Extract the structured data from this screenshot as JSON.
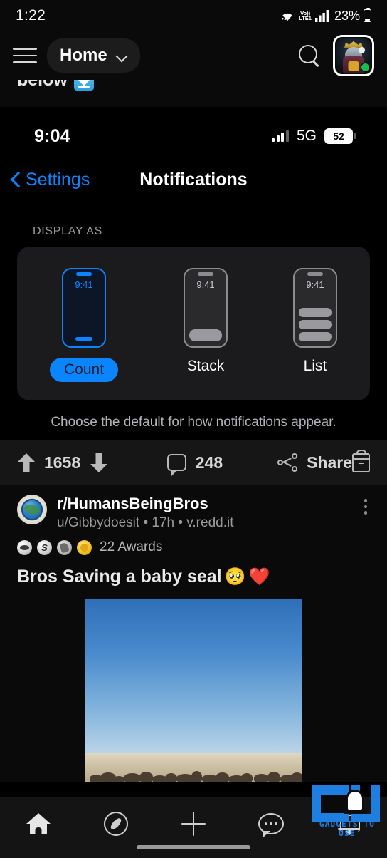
{
  "android_status": {
    "time": "1:22",
    "volte_top": "Vo))",
    "volte_bottom": "LTE1",
    "battery_percent": "23%",
    "wifi_icon": "wifi-icon",
    "signal_icon": "cellular-signal-icon",
    "battery_icon": "battery-icon"
  },
  "reddit_topbar": {
    "menu_icon": "hamburger-menu-icon",
    "feed_label": "Home",
    "chevron_icon": "chevron-down-icon",
    "search_icon": "search-icon",
    "avatar_name": "user-avatar",
    "online_status": "online"
  },
  "cutoff_post": {
    "text": "below",
    "emoji": "down-arrow-emoji"
  },
  "ios_screenshot": {
    "status": {
      "time": "9:04",
      "network": "5G",
      "battery": "52",
      "signal_icon": "cellular-signal-icon",
      "battery_icon": "battery-icon"
    },
    "nav": {
      "back_label": "Settings",
      "back_icon": "chevron-left-icon",
      "title": "Notifications"
    },
    "section_label": "DISPLAY AS",
    "options": [
      {
        "label": "Count",
        "phone_time": "9:41",
        "selected": true
      },
      {
        "label": "Stack",
        "phone_time": "9:41",
        "selected": false
      },
      {
        "label": "List",
        "phone_time": "9:41",
        "selected": false
      }
    ],
    "footnote": "Choose the default for how notifications appear.",
    "accent_color": "#0a84ff"
  },
  "action_bar": {
    "upvote_icon": "upvote-arrow-icon",
    "score": "1658",
    "downvote_icon": "downvote-arrow-icon",
    "comment_icon": "comment-bubble-icon",
    "comments": "248",
    "share_icon": "share-icon",
    "share_label": "Share",
    "award_icon": "give-award-icon"
  },
  "post": {
    "subreddit_avatar": "subreddit-avatar-globe",
    "subreddit": "r/HumansBeingBros",
    "meta": "u/Gibbydoesit • 17h • v.redd.it",
    "more_icon": "overflow-menu-icon",
    "awards_count": "22 Awards",
    "award_badges": [
      "silver-award-icon",
      "s-award-icon",
      "handshake-award-icon",
      "gold-award-icon"
    ],
    "title": "Bros Saving a baby seal",
    "title_emoji_1": "🥺",
    "title_emoji_2": "❤️",
    "media_alt": "seal-colony-video-thumbnail"
  },
  "bottom_nav": {
    "items": [
      {
        "name": "home-nav-icon"
      },
      {
        "name": "discover-compass-nav-icon"
      },
      {
        "name": "create-post-plus-icon"
      },
      {
        "name": "chat-nav-icon"
      },
      {
        "name": "notifications-bell-nav-icon"
      }
    ]
  },
  "watermark": {
    "text": "GADGETS TO USE",
    "logo": "gadgets-to-use-logo",
    "brand_color": "#1f7fe0"
  }
}
